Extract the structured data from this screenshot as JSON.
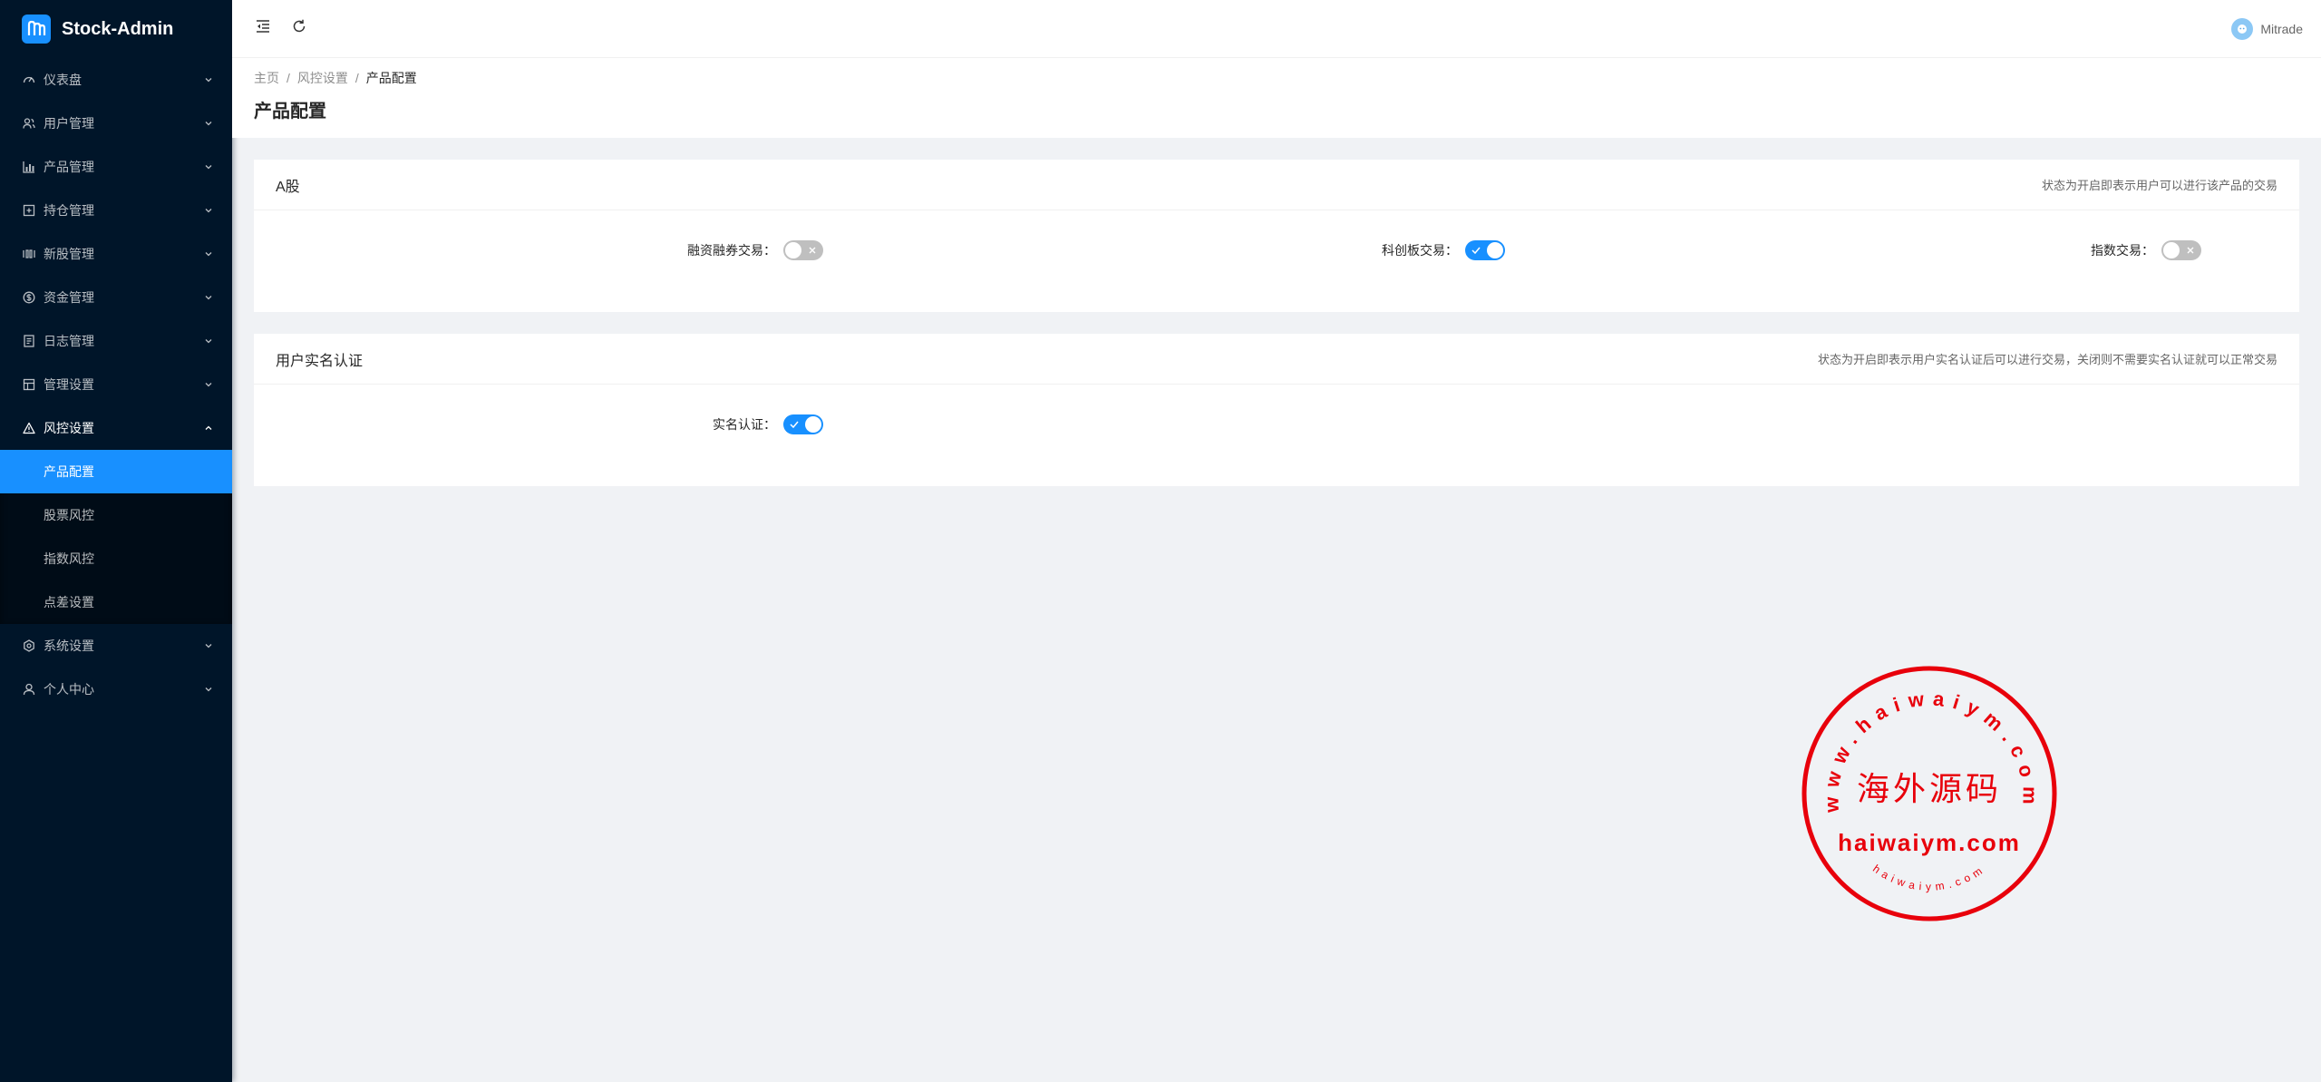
{
  "app": {
    "title": "Stock-Admin"
  },
  "colors": {
    "sidebar_bg": "#001529",
    "accent": "#1890ff",
    "stamp_red": "#e8000b"
  },
  "sidebar": {
    "items": [
      {
        "label": "仪表盘",
        "icon": "dashboard-icon"
      },
      {
        "label": "用户管理",
        "icon": "users-icon"
      },
      {
        "label": "产品管理",
        "icon": "bar-chart-icon"
      },
      {
        "label": "持仓管理",
        "icon": "position-icon"
      },
      {
        "label": "新股管理",
        "icon": "new-stock-icon"
      },
      {
        "label": "资金管理",
        "icon": "money-icon"
      },
      {
        "label": "日志管理",
        "icon": "log-icon"
      },
      {
        "label": "管理设置",
        "icon": "admin-settings-icon"
      },
      {
        "label": "风控设置",
        "icon": "warning-icon",
        "open": true
      },
      {
        "label": "系统设置",
        "icon": "gear-icon"
      },
      {
        "label": "个人中心",
        "icon": "user-icon"
      }
    ],
    "risk_submenu": [
      {
        "label": "产品配置",
        "active": true
      },
      {
        "label": "股票风控"
      },
      {
        "label": "指数风控"
      },
      {
        "label": "点差设置"
      }
    ]
  },
  "header": {
    "username": "Mitrade"
  },
  "breadcrumb": {
    "home": "主页",
    "parent": "风控设置",
    "current": "产品配置",
    "separator": "/"
  },
  "page": {
    "title": "产品配置"
  },
  "card_a": {
    "title": "A股",
    "note": "状态为开启即表示用户可以进行该产品的交易",
    "switches": [
      {
        "label": "融资融券交易：",
        "on": false
      },
      {
        "label": "科创板交易：",
        "on": true
      },
      {
        "label": "指数交易：",
        "on": false
      }
    ]
  },
  "card_auth": {
    "title": "用户实名认证",
    "note": "状态为开启即表示用户实名认证后可以进行交易，关闭则不需要实名认证就可以正常交易",
    "switches": [
      {
        "label": "实名认证：",
        "on": true
      }
    ]
  },
  "stamp": {
    "arc_text": "www.haiwaiym.com",
    "center_text": "海外源码",
    "domain_text": "haiwaiym.com",
    "small_arc_text": "haiwaiym.com"
  }
}
